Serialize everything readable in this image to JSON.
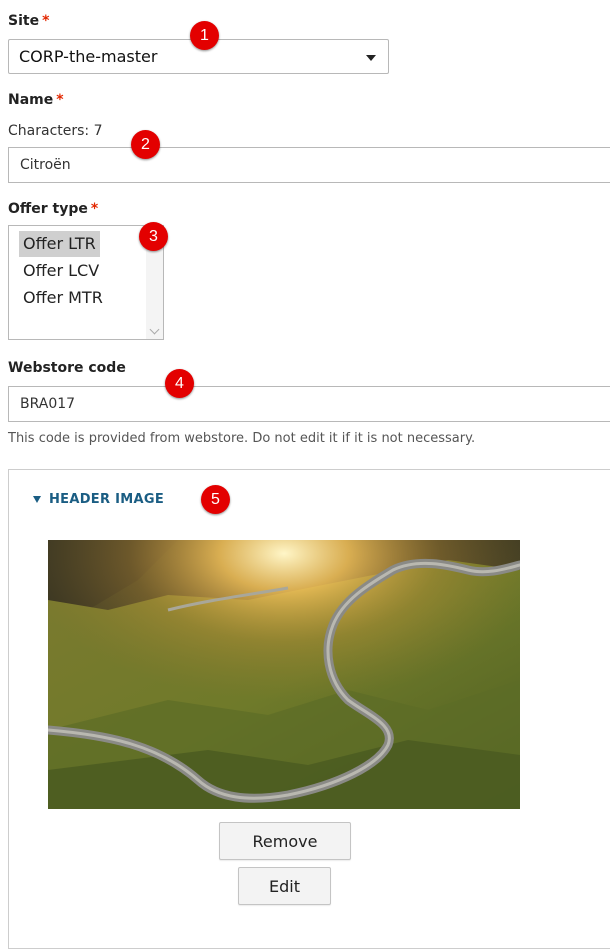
{
  "site": {
    "label": "Site",
    "required_mark": "*",
    "value": "CORP-the-master",
    "marker": "1"
  },
  "name": {
    "label": "Name",
    "required_mark": "*",
    "char_count": "Characters: 7",
    "value": "Citroën",
    "marker": "2"
  },
  "offer_type": {
    "label": "Offer type",
    "required_mark": "*",
    "options": [
      "Offer LTR",
      "Offer LCV",
      "Offer MTR"
    ],
    "selected": "Offer LTR",
    "marker": "3"
  },
  "webstore": {
    "label": "Webstore code",
    "value": "BRA017",
    "description": "This code is provided from webstore. Do not edit it if it is not necessary.",
    "marker": "4"
  },
  "header_image": {
    "summary": "HEADER IMAGE",
    "marker": "5",
    "remove_label": "Remove",
    "edit_label": "Edit"
  },
  "colors": {
    "required": "#e32700",
    "marker": "#e30000",
    "link": "#1a5d83"
  }
}
